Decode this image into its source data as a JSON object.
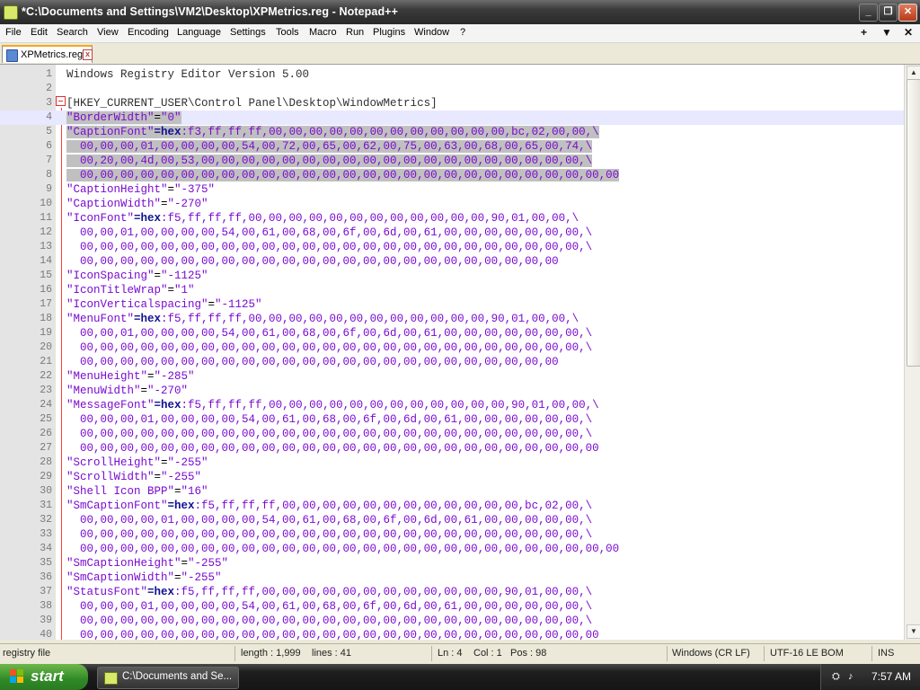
{
  "window": {
    "title": "*C:\\Documents and Settings\\VM2\\Desktop\\XPMetrics.reg - Notepad++",
    "minimize": "_",
    "maximize": "❐",
    "close": "✕"
  },
  "menu": {
    "items": [
      "File",
      "Edit",
      "Search",
      "View",
      "Encoding",
      "Language",
      "Settings",
      "Tools",
      "Macro",
      "Run",
      "Plugins",
      "Window",
      "?"
    ],
    "right": [
      "+",
      "▼",
      "✕"
    ]
  },
  "tab": {
    "label": "XPMetrics.reg",
    "close": "x"
  },
  "editor": {
    "lines": [
      {
        "n": "1",
        "t": "plain",
        "a": "Windows Registry Editor Version 5.00"
      },
      {
        "n": "2",
        "t": "blank",
        "a": ""
      },
      {
        "n": "3",
        "t": "hdr",
        "a": "[HKEY_CURRENT_USER\\Control Panel\\Desktop\\WindowMetrics]"
      },
      {
        "n": "4",
        "t": "kv",
        "a": "\"BorderWidth\"",
        "b": "=",
        "c": "\"0\"",
        "sel": "true",
        "cur": "true"
      },
      {
        "n": "5",
        "t": "hex",
        "a": "\"CaptionFont\"",
        "b": "=hex",
        "c": ":f3,ff,ff,ff,00,00,00,00,00,00,00,00,00,00,00,00,bc,02,00,00,\\",
        "sel": "true"
      },
      {
        "n": "6",
        "t": "cont",
        "a": "  00,00,00,01,00,00,00,00,54,00,72,00,65,00,62,00,75,00,63,00,68,00,65,00,74,\\",
        "sel": "true"
      },
      {
        "n": "7",
        "t": "cont",
        "a": "  00,20,00,4d,00,53,00,00,00,00,00,00,00,00,00,00,00,00,00,00,00,00,00,00,00,\\",
        "sel": "true"
      },
      {
        "n": "8",
        "t": "cont",
        "a": "  00,00,00,00,00,00,00,00,00,00,00,00,00,00,00,00,00,00,00,00,00,00,00,00,00,00,00",
        "sel": "true"
      },
      {
        "n": "9",
        "t": "kv",
        "a": "\"CaptionHeight\"",
        "b": "=",
        "c": "\"-375\""
      },
      {
        "n": "10",
        "t": "kv",
        "a": "\"CaptionWidth\"",
        "b": "=",
        "c": "\"-270\""
      },
      {
        "n": "11",
        "t": "hex",
        "a": "\"IconFont\"",
        "b": "=hex",
        "c": ":f5,ff,ff,ff,00,00,00,00,00,00,00,00,00,00,00,00,90,01,00,00,\\"
      },
      {
        "n": "12",
        "t": "cont",
        "a": "  00,00,01,00,00,00,00,54,00,61,00,68,00,6f,00,6d,00,61,00,00,00,00,00,00,00,\\"
      },
      {
        "n": "13",
        "t": "cont",
        "a": "  00,00,00,00,00,00,00,00,00,00,00,00,00,00,00,00,00,00,00,00,00,00,00,00,00,\\"
      },
      {
        "n": "14",
        "t": "cont",
        "a": "  00,00,00,00,00,00,00,00,00,00,00,00,00,00,00,00,00,00,00,00,00,00,00,00"
      },
      {
        "n": "15",
        "t": "kv",
        "a": "\"IconSpacing\"",
        "b": "=",
        "c": "\"-1125\""
      },
      {
        "n": "16",
        "t": "kv",
        "a": "\"IconTitleWrap\"",
        "b": "=",
        "c": "\"1\""
      },
      {
        "n": "17",
        "t": "kv",
        "a": "\"IconVerticalspacing\"",
        "b": "=",
        "c": "\"-1125\""
      },
      {
        "n": "18",
        "t": "hex",
        "a": "\"MenuFont\"",
        "b": "=hex",
        "c": ":f5,ff,ff,ff,00,00,00,00,00,00,00,00,00,00,00,00,90,01,00,00,\\"
      },
      {
        "n": "19",
        "t": "cont",
        "a": "  00,00,01,00,00,00,00,54,00,61,00,68,00,6f,00,6d,00,61,00,00,00,00,00,00,00,\\"
      },
      {
        "n": "20",
        "t": "cont",
        "a": "  00,00,00,00,00,00,00,00,00,00,00,00,00,00,00,00,00,00,00,00,00,00,00,00,00,\\"
      },
      {
        "n": "21",
        "t": "cont",
        "a": "  00,00,00,00,00,00,00,00,00,00,00,00,00,00,00,00,00,00,00,00,00,00,00,00"
      },
      {
        "n": "22",
        "t": "kv",
        "a": "\"MenuHeight\"",
        "b": "=",
        "c": "\"-285\""
      },
      {
        "n": "23",
        "t": "kv",
        "a": "\"MenuWidth\"",
        "b": "=",
        "c": "\"-270\""
      },
      {
        "n": "24",
        "t": "hex",
        "a": "\"MessageFont\"",
        "b": "=hex",
        "c": ":f5,ff,ff,ff,00,00,00,00,00,00,00,00,00,00,00,00,90,01,00,00,\\"
      },
      {
        "n": "25",
        "t": "cont",
        "a": "  00,00,00,01,00,00,00,00,54,00,61,00,68,00,6f,00,6d,00,61,00,00,00,00,00,00,\\"
      },
      {
        "n": "26",
        "t": "cont",
        "a": "  00,00,00,00,00,00,00,00,00,00,00,00,00,00,00,00,00,00,00,00,00,00,00,00,00,\\"
      },
      {
        "n": "27",
        "t": "cont",
        "a": "  00,00,00,00,00,00,00,00,00,00,00,00,00,00,00,00,00,00,00,00,00,00,00,00,00,00"
      },
      {
        "n": "28",
        "t": "kv",
        "a": "\"ScrollHeight\"",
        "b": "=",
        "c": "\"-255\""
      },
      {
        "n": "29",
        "t": "kv",
        "a": "\"ScrollWidth\"",
        "b": "=",
        "c": "\"-255\""
      },
      {
        "n": "30",
        "t": "kv",
        "a": "\"Shell Icon BPP\"",
        "b": "=",
        "c": "\"16\""
      },
      {
        "n": "31",
        "t": "hex",
        "a": "\"SmCaptionFont\"",
        "b": "=hex",
        "c": ":f5,ff,ff,ff,00,00,00,00,00,00,00,00,00,00,00,00,bc,02,00,\\"
      },
      {
        "n": "32",
        "t": "cont",
        "a": "  00,00,00,00,01,00,00,00,00,54,00,61,00,68,00,6f,00,6d,00,61,00,00,00,00,00,\\"
      },
      {
        "n": "33",
        "t": "cont",
        "a": "  00,00,00,00,00,00,00,00,00,00,00,00,00,00,00,00,00,00,00,00,00,00,00,00,00,\\"
      },
      {
        "n": "34",
        "t": "cont",
        "a": "  00,00,00,00,00,00,00,00,00,00,00,00,00,00,00,00,00,00,00,00,00,00,00,00,00,00,00"
      },
      {
        "n": "35",
        "t": "kv",
        "a": "\"SmCaptionHeight\"",
        "b": "=",
        "c": "\"-255\""
      },
      {
        "n": "36",
        "t": "kv",
        "a": "\"SmCaptionWidth\"",
        "b": "=",
        "c": "\"-255\""
      },
      {
        "n": "37",
        "t": "hex",
        "a": "\"StatusFont\"",
        "b": "=hex",
        "c": ":f5,ff,ff,ff,00,00,00,00,00,00,00,00,00,00,00,00,90,01,00,00,\\"
      },
      {
        "n": "38",
        "t": "cont",
        "a": "  00,00,00,01,00,00,00,00,54,00,61,00,68,00,6f,00,6d,00,61,00,00,00,00,00,00,\\"
      },
      {
        "n": "39",
        "t": "cont",
        "a": "  00,00,00,00,00,00,00,00,00,00,00,00,00,00,00,00,00,00,00,00,00,00,00,00,00,\\"
      },
      {
        "n": "40",
        "t": "cont",
        "a": "  00,00,00,00,00,00,00,00,00,00,00,00,00,00,00,00,00,00,00,00,00,00,00,00,00,00"
      }
    ]
  },
  "status": {
    "type": "registry file",
    "length": "length : 1,999",
    "lines": "lines : 41",
    "ln": "Ln : 4",
    "col": "Col : 1",
    "pos": "Pos : 98",
    "eol": "Windows (CR LF)",
    "encoding": "UTF-16 LE BOM",
    "mode": "INS"
  },
  "taskbar": {
    "start": "start",
    "task": "C:\\Documents and Se...",
    "clock": "7:57 AM"
  },
  "colors": {
    "string": "#7a0ad0",
    "keyword": "#101090",
    "selection": "#c0c0c0",
    "fold": "#e03030"
  }
}
